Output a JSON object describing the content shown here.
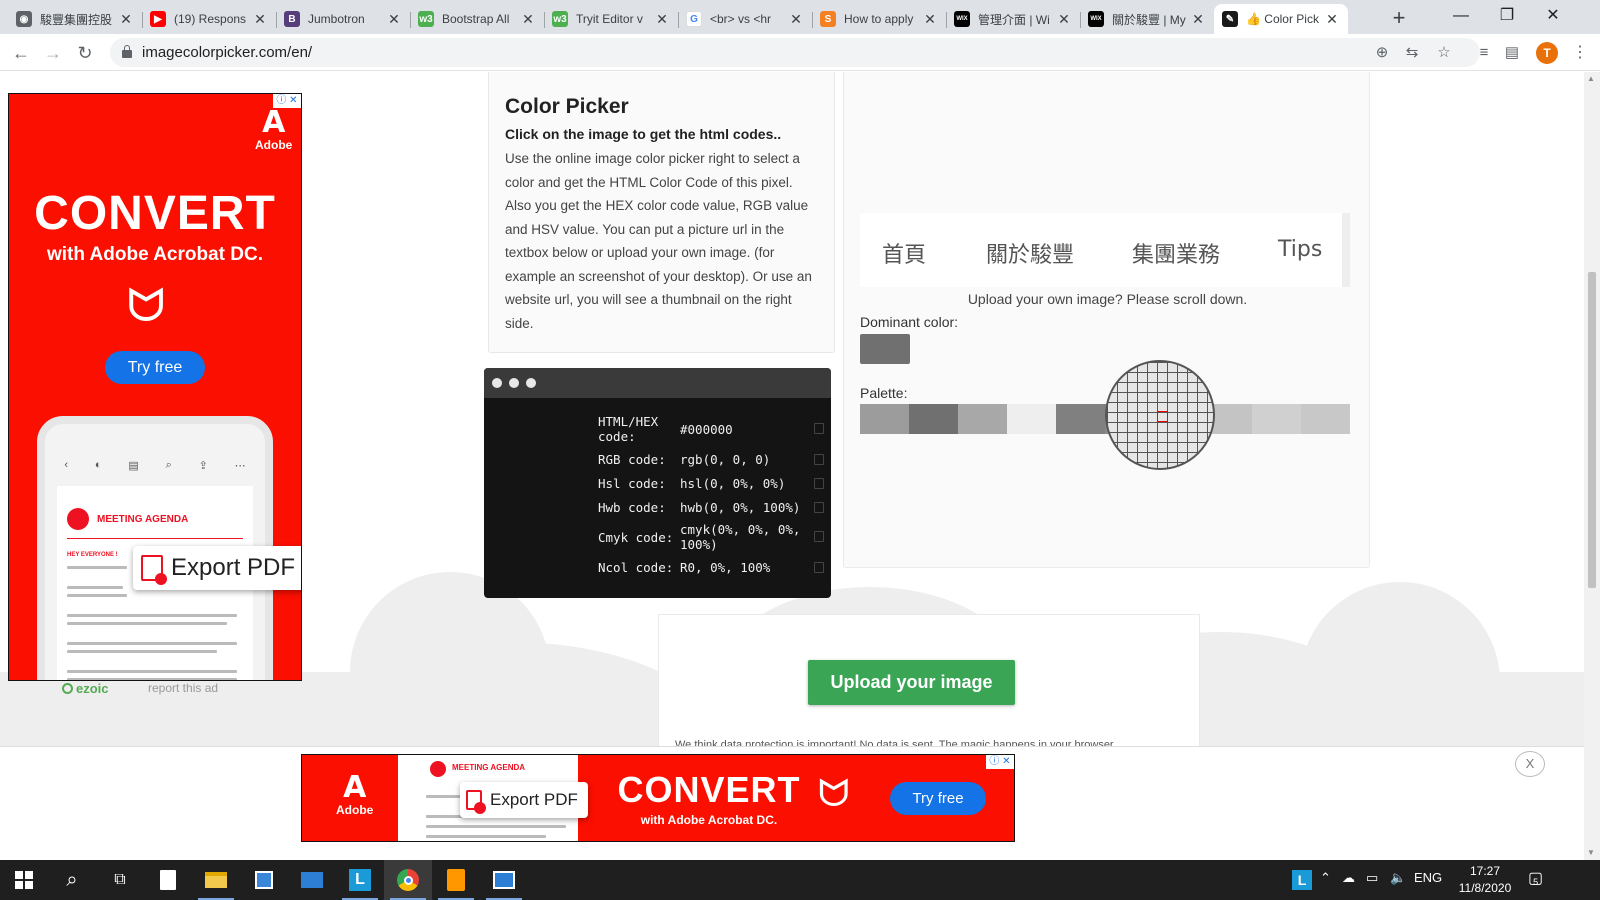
{
  "browser": {
    "tabs": [
      {
        "title": "駿豐集團控股",
        "fav_color": "#5f6368",
        "fav_glyph": "◉"
      },
      {
        "title": "(19) Respons",
        "fav_color": "#ff0000",
        "fav_glyph": "▶"
      },
      {
        "title": "Jumbotron",
        "fav_color": "#563d7c",
        "fav_glyph": "B"
      },
      {
        "title": "Bootstrap All",
        "fav_color": "#4caf50",
        "fav_glyph": "w3"
      },
      {
        "title": "Tryit Editor v",
        "fav_color": "#4caf50",
        "fav_glyph": "w3"
      },
      {
        "title": "<br> vs <hr",
        "fav_color": "#ffffff",
        "fav_glyph": "G"
      },
      {
        "title": "How to apply",
        "fav_color": "#f48024",
        "fav_glyph": "S"
      },
      {
        "title": "管理介面 | Wi",
        "fav_color": "#000000",
        "fav_glyph": "WIX"
      },
      {
        "title": "關於駿豐 | My",
        "fav_color": "#000000",
        "fav_glyph": "WIX"
      },
      {
        "title": "👍 Color Pick",
        "fav_color": "#1a1a1a",
        "fav_glyph": "✎"
      }
    ],
    "active_tab_index": 9,
    "url": "imagecolorpicker.com/en/",
    "profile_initial": "T"
  },
  "ad_left": {
    "brand": "Adobe",
    "headline": "CONVERT",
    "subline": "with Adobe Acrobat DC.",
    "cta": "Try free",
    "doc_title": "MEETING AGENDA",
    "doc_greeting": "HEY EVERYONE !",
    "export_label": "Export PDF",
    "network": "ezoic",
    "report": "report this ad"
  },
  "info": {
    "title": "Color Picker",
    "lead": "Click on the image to get the html codes..",
    "body": "Use the online image color picker right to select a color and get the HTML Color Code of this pixel. Also you get the HEX color code value, RGB value and HSV value. You can put a picture url in the textbox below or upload your own image. (for example an screenshot of your desktop). Or use an website url, you will see a thumbnail on the right side."
  },
  "codes": [
    {
      "label": "HTML/HEX code:",
      "value": "#000000"
    },
    {
      "label": "RGB code:",
      "value": "rgb(0, 0, 0)"
    },
    {
      "label": "Hsl code:",
      "value": "hsl(0, 0%, 0%)"
    },
    {
      "label": "Hwb code:",
      "value": "hwb(0, 0%, 100%)"
    },
    {
      "label": "Cmyk code:",
      "value": "cmyk(0%, 0%, 0%, 100%)"
    },
    {
      "label": "Ncol code:",
      "value": "R0, 0%, 100%"
    }
  ],
  "preview": {
    "nav_items": [
      "首頁",
      "關於駿豐",
      "集團業務",
      "Tips"
    ],
    "upload_hint": "Upload your own image? Please scroll down.",
    "dominant_label": "Dominant color:",
    "dominant_color": "#707070",
    "palette_label": "Palette:",
    "palette": [
      "#9c9c9c",
      "#707070",
      "#a8a8a8",
      "#eeeeee",
      "#808080",
      "#8a8a8a",
      "#b8b8b8",
      "#c4c4c4",
      "#d0d0d0",
      "#c8c8c8"
    ]
  },
  "upload": {
    "button": "Upload your image",
    "privacy": "We think data protection is important! No data is sent. The magic happens in your browser."
  },
  "ad_bottom": {
    "brand": "Adobe",
    "doc_title": "MEETING AGENDA",
    "export_label": "Export PDF",
    "headline": "CONVERT",
    "subline": "with Adobe Acrobat DC.",
    "cta": "Try free",
    "close": "X"
  },
  "taskbar": {
    "language": "ENG",
    "time": "17:27",
    "date": "11/8/2020",
    "notifications": "5"
  }
}
